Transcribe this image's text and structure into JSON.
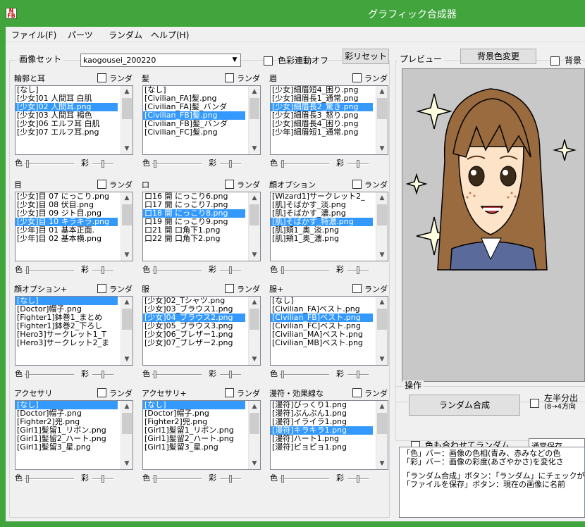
{
  "window": {
    "title": "グラフィック合成器",
    "icon": "app-icon"
  },
  "menu": [
    "ファイル(F)",
    "パーツ",
    "ランダム",
    "ヘルプ(H)"
  ],
  "image_set": {
    "label": "画像セット",
    "value": "kaogousei_200220",
    "color_sync_label": "色彩連動オフ",
    "reset_button": "彩リセット"
  },
  "preview": {
    "label": "プレビュー",
    "bg_button": "背景色変更",
    "bg_check_label": "背景"
  },
  "slider_labels": {
    "color": "色",
    "saturation": "彩"
  },
  "random_label": "ランダム",
  "parts": [
    {
      "name": "輪郭と耳",
      "items": [
        "[なし]",
        "[少女]01 人間耳 白肌",
        "[少女]02 人間耳.png",
        "[少女]03 人間耳 褐色",
        "[少女]06 エルフ耳 白肌",
        "[少女]07 エルフ耳.png"
      ],
      "selected": 2
    },
    {
      "name": "髪",
      "items": [
        "[なし]",
        "[Civilian_FA]髪.png",
        "[Civilian_FA]髪_バンダ",
        "[Civilian_FB]髪.png",
        "[Civilian_FB]髪_バンダ",
        "[Civilian_FC]髪.png"
      ],
      "selected": 3
    },
    {
      "name": "眉",
      "items": [
        "[少女]細眉短4_困り.png",
        "[少女]細眉長1_通常.png",
        "[少女]細眉長2_驚き.png",
        "[少女]細眉長3_怒り.png",
        "[少女]細眉長4_困り.png",
        "[少年]細眉短1_通常.png"
      ],
      "selected": 2
    },
    {
      "name": "目",
      "items": [
        "[少女]目 07 にっこり.png",
        "[少女]目 08 伏目.png",
        "[少女]目 09 ジト目.png",
        "[少女]目 10 キラキラ.png",
        "[少年]目 01 基本正面.",
        "[少年]目 02 基本横.png"
      ],
      "selected": 3
    },
    {
      "name": "口",
      "items": [
        "口16 開 にっこり6.png",
        "口17 開 にっこり7.png",
        "口18 開 にっこり8.png",
        "口19 開 にっこり9.png",
        "口21 開 口角下1.png",
        "口22 開 口角下2.png"
      ],
      "selected": 2
    },
    {
      "name": "顔オプション",
      "items": [
        "[Wizard1]サークレット2_",
        "[肌]そばかす_淡.png",
        "[肌]そばかす_濃.png",
        "[肌]そばかす_特濃.png",
        "[肌]頬1_奥_淡.png",
        "[肌]頬1_奥_濃.png"
      ],
      "selected": 3
    },
    {
      "name": "顔オプション+",
      "items": [
        "[なし]",
        "[Doctor]帽子.png",
        "[Fighter1]鉢巻1_まとめ",
        "[Fighter1]鉢巻2_下ろし",
        "[Hero3]サークレット1_T",
        "[Hero3]サークレット2_ま"
      ],
      "selected": 0
    },
    {
      "name": "服",
      "items": [
        "[少女]02_Tシャツ.png",
        "[少女]03_ブラウス1.png",
        "[少女]04_ブラウス2.png",
        "[少女]05_ブラウス3.png",
        "[少女]06_ブレザー1.png",
        "[少女]07_ブレザー2.png"
      ],
      "selected": 2
    },
    {
      "name": "服+",
      "items": [
        "[なし]",
        "[Civilian_FA]ベスト.png",
        "[Civilian_FB]ベスト.png",
        "[Civilian_FC]ベスト.png",
        "[Civilian_MA]ベスト.png",
        "[Civilian_MB]ベスト.png"
      ],
      "selected": 2
    },
    {
      "name": "アクセサリ",
      "items": [
        "[なし]",
        "[Doctor]帽子.png",
        "[Fighter2]兜.png",
        "[Girl1]髪留1_リボン.png",
        "[Girl1]髪留2_ハート.png",
        "[Girl1]髪留3_星.png"
      ],
      "selected": 0
    },
    {
      "name": "アクセサリ+",
      "items": [
        "[なし]",
        "[Doctor]帽子.png",
        "[Fighter2]兜.png",
        "[Girl1]髪留1_リボン.png",
        "[Girl1]髪留2_ハート.png",
        "[Girl1]髪留3_星.png"
      ],
      "selected": 0
    },
    {
      "name": "漫符・効果線な",
      "items": [
        "[漫符]びっくり1.png",
        "[漫符]ぷんぷん1.png",
        "[漫符]イライラ1.png",
        "[漫符]キラキラ1.png",
        "[漫符]ハート1.png",
        "[漫符]ピョピョ1.png"
      ],
      "selected": 3
    }
  ],
  "operations": {
    "label": "操作",
    "random_compose_button": "ランダム合成",
    "split_label_1": "左半分出",
    "split_label_2": "(8→4方向",
    "color_random_label": "色も合わせてランダム",
    "save_mode": "通常保存"
  },
  "info_lines": [
    "「色」バー：画像の色相(青み、赤みなどの色",
    "「彩」バー：画像の彩度(あざやかさ)を変化さ",
    "",
    "「ランダム合成」ボタン：「ランダム」にチェックが",
    "「ファイルを保存」ボタン：現在の画像に名前"
  ],
  "colors": {
    "titlebar": "#41a43c",
    "selection": "#3399ff",
    "preview_bg": "#c8c8c8"
  }
}
